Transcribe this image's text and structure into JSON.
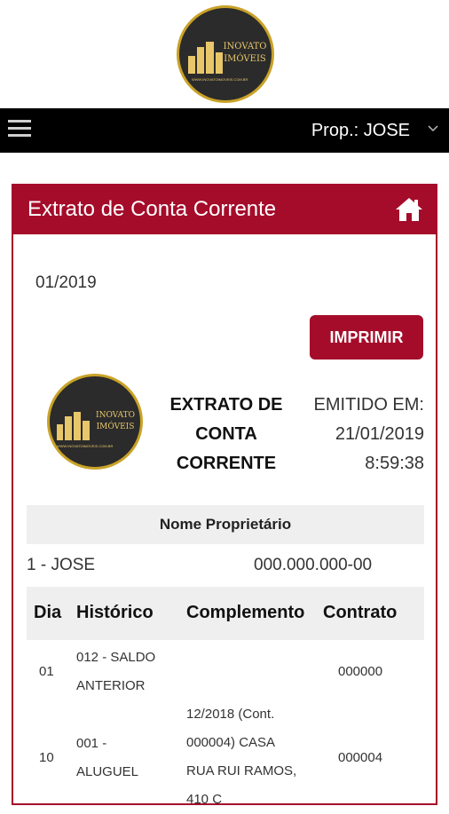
{
  "header": {
    "logo": {
      "line1": "INOVATO",
      "line2": "IMÓVEIS",
      "tagline": "WWW.INOVATOIMOVEIS.COM.BR"
    },
    "icons": {
      "menu": "hamburger-icon",
      "chevron": "chevron-down-icon",
      "home": "home-icon"
    }
  },
  "navbar": {
    "prop_label": "Prop.: JOSE"
  },
  "panel": {
    "title": "Extrato de Conta Corrente",
    "period": "01/2019",
    "print_label": "IMPRIMIR",
    "doc_title": [
      "EXTRATO DE",
      "CONTA",
      "CORRENTE"
    ],
    "issued_label": "EMITIDO EM:",
    "issued_date": "21/01/2019",
    "issued_time": "8:59:38"
  },
  "owner": {
    "header": "Nome Proprietário",
    "name": "1 - JOSE",
    "document": "000.000.000-00"
  },
  "table": {
    "columns": [
      "Dia",
      "Histórico",
      "Complemento",
      "Contrato"
    ],
    "rows": [
      {
        "dia": "01",
        "historico": [
          "012 - SALDO",
          "ANTERIOR"
        ],
        "complemento": [],
        "contrato": "000000"
      },
      {
        "dia": "10",
        "historico": [
          "001 -",
          "ALUGUEL"
        ],
        "complemento": [
          "12/2018 (Cont.",
          "000004) CASA",
          "RUA RUI RAMOS,",
          "410 C"
        ],
        "contrato": "000004"
      }
    ]
  },
  "colors": {
    "accent": "#a50c2a",
    "navbar": "#000000",
    "logo_gold": "#c9a227"
  }
}
